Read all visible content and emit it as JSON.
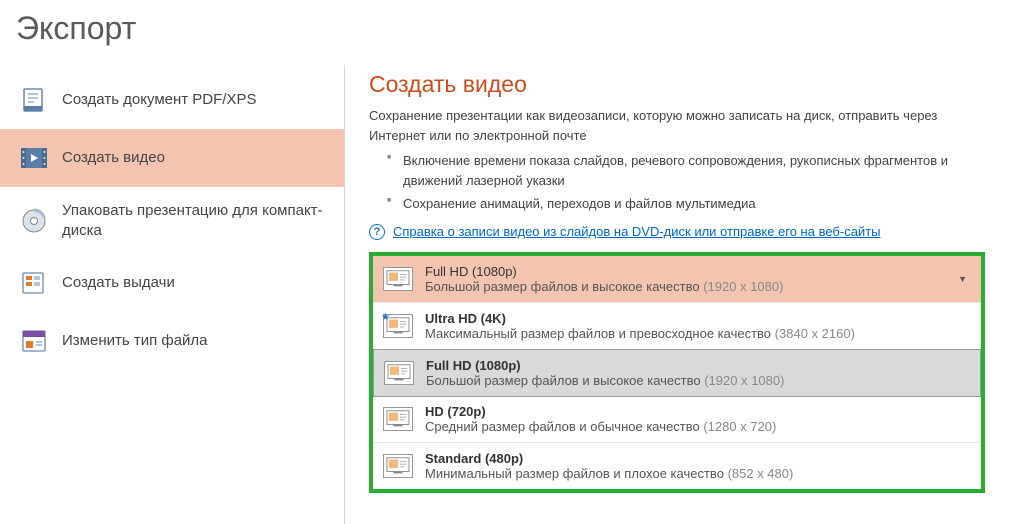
{
  "page_title": "Экспорт",
  "sidebar": {
    "items": [
      {
        "label": "Создать документ PDF/XPS"
      },
      {
        "label": "Создать видео"
      },
      {
        "label": "Упаковать презентацию для компакт-диска"
      },
      {
        "label": "Создать выдачи"
      },
      {
        "label": "Изменить тип файла"
      }
    ]
  },
  "main": {
    "heading": "Создать видео",
    "description": "Сохранение презентации как видеозаписи, которую можно записать на диск, отправить через Интернет или по электронной почте",
    "bullets": [
      "Включение времени показа слайдов, речевого сопровождения, рукописных фрагментов и движений лазерной указки",
      "Сохранение анимаций, переходов и файлов мультимедиа"
    ],
    "help_link": "Справка о записи видео из слайдов на DVD-диск или отправке его на веб-сайты"
  },
  "dropdown": {
    "selected": {
      "title": "Full HD (1080p)",
      "desc": "Большой размер файлов и высокое качество",
      "res": "(1920 x 1080)"
    },
    "options": [
      {
        "title": "Ultra HD (4K)",
        "desc": "Максимальный размер файлов и превосходное качество",
        "res": "(3840 x 2160)",
        "star": true
      },
      {
        "title": "Full HD (1080p)",
        "desc": "Большой размер файлов и высокое качество",
        "res": "(1920 x 1080)",
        "highlight": true
      },
      {
        "title": "HD (720p)",
        "desc": "Средний размер файлов и обычное качество",
        "res": "(1280 x 720)"
      },
      {
        "title": "Standard (480p)",
        "desc": "Минимальный размер файлов и плохое качество",
        "res": "(852 x 480)"
      }
    ]
  }
}
